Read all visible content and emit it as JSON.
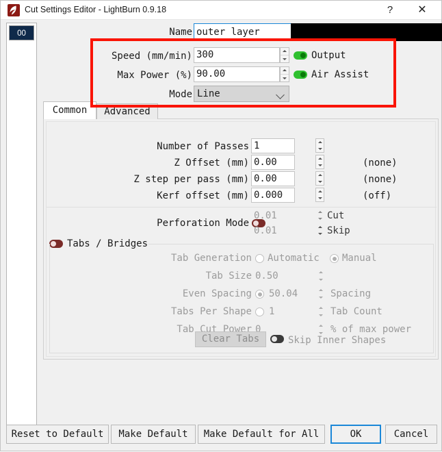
{
  "window": {
    "title": "Cut Settings Editor - LightBurn 0.9.18",
    "app_icon": "lightburn-icon",
    "help_label": "?",
    "close_label": "✕"
  },
  "layer_list": {
    "items": [
      {
        "label": "00",
        "color": "#0f2a4a"
      }
    ]
  },
  "settings": {
    "name": {
      "label": "Name",
      "value": "outer layer"
    },
    "speed": {
      "label": "Speed (mm/min)",
      "value": "300"
    },
    "max_power": {
      "label": "Max Power (%)",
      "value": "90.00"
    },
    "mode": {
      "label": "Mode",
      "value": "Line"
    },
    "output": {
      "label": "Output",
      "state": "on"
    },
    "air_assist": {
      "label": "Air Assist",
      "state": "on"
    }
  },
  "tabs": {
    "items": [
      {
        "label": "Common",
        "active": true
      },
      {
        "label": "Advanced",
        "active": false
      }
    ]
  },
  "common": {
    "rows": [
      {
        "label": "Number of Passes",
        "value": "1",
        "suffix": ""
      },
      {
        "label": "Z Offset (mm)",
        "value": "0.00",
        "suffix": "(none)"
      },
      {
        "label": "Z step per pass (mm)",
        "value": "0.00",
        "suffix": "(none)"
      },
      {
        "label": "Kerf offset (mm)",
        "value": "0.000",
        "suffix": "(off)"
      }
    ],
    "perforation": {
      "label": "Perforation Mode",
      "state": "off",
      "cut_value": "0.01",
      "cut_suffix": "Cut",
      "skip_value": "0.01",
      "skip_suffix": "Skip"
    },
    "tabs_bridges": {
      "title": "Tabs / Bridges",
      "state": "off",
      "tab_generation": {
        "label": "Tab Generation",
        "options": [
          "Automatic",
          "Manual"
        ],
        "selected": "Manual"
      },
      "tab_size": {
        "label": "Tab Size",
        "value": "0.50"
      },
      "even_spacing": {
        "label": "Even Spacing",
        "value": "50.04",
        "suffix": "Spacing",
        "selected": true
      },
      "tabs_per_shape": {
        "label": "Tabs Per Shape",
        "value": "1",
        "suffix": "Tab Count",
        "selected": false
      },
      "tab_cut_power": {
        "label": "Tab Cut Power",
        "value": "0",
        "suffix": "% of max power"
      },
      "clear_tabs_label": "Clear Tabs",
      "skip_inner": {
        "label": "Skip Inner Shapes",
        "state": "off"
      }
    }
  },
  "buttons": {
    "reset": "Reset to Default",
    "make_default": "Make Default",
    "make_default_all": "Make Default for All",
    "ok": "OK",
    "cancel": "Cancel"
  },
  "annotation": {
    "color": "#fa1405",
    "shape": "rectangle-highlight"
  }
}
